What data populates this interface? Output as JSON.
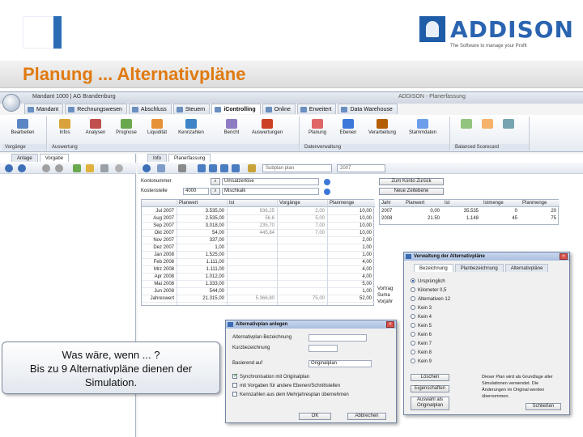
{
  "slide": {
    "title": "Planung ... Alternativpläne",
    "logo_name": "ADDISON",
    "logo_tagline": "The Software to manage your Profit",
    "callout_line1": "Was wäre, wenn ... ?",
    "callout_line2": "Bis zu 9 Alternativpläne dienen der",
    "callout_line3": "Simulation."
  },
  "app": {
    "title": "Mandant 1000 | AG Brandenburg",
    "title_right": "ADDISON - Planerfassung",
    "menu_tabs": [
      "Mandant",
      "Rechnungswesen",
      "Abschluss",
      "Steuern",
      "iControlling",
      "Online",
      "Erweitert",
      "Data Warehouse"
    ],
    "ribbon": {
      "groups": [
        "Vorgänge",
        "Auswertung",
        "Datenverwaltung",
        "Balanced Scorecard"
      ],
      "buttons": [
        "Bearbeiten",
        "Infos",
        "Analysen",
        "Prognose",
        "Liquidität",
        "Kennzahlen",
        "Bericht",
        "Auswertungen",
        "Planung",
        "Ebenen",
        "Verarbeitung",
        "Stammdaten"
      ]
    },
    "left_tabs": [
      "Anlage",
      "Vorgabe"
    ],
    "main_tabs": [
      "Info",
      "Planerfassung"
    ],
    "combo_plan": "Subplan plan",
    "combo_year": "2007"
  },
  "form": {
    "label_konto": "Kontonummer",
    "konto_value": "Umsatzerlöse",
    "label_kostenstelle": "Kostenstelle",
    "kostenstelle_num": "4000",
    "kostenstelle_value": "Mischkalk",
    "btn_zum_konto": "Zum Konto Zurück",
    "btn_neue_zeile": "Neue Zeitebene",
    "col_planwert": "Planwert",
    "col_ist": "Ist",
    "col_vorgang": "Vorgänge",
    "col_planmenge": "Planmenge",
    "right_cols": [
      "Jahr",
      "Planwert",
      "Ist",
      "Istmenge",
      "Planmenge"
    ],
    "right_rows": [
      [
        "2007",
        "0,00",
        "35.535",
        "0",
        "20"
      ],
      [
        "2008",
        "21.50",
        "1,148",
        "45",
        "75"
      ]
    ],
    "months": [
      {
        "m": "Jul 2007",
        "plan": "3.535,00",
        "ist": "936,25",
        "v": "2,00",
        "pm": "10,00"
      },
      {
        "m": "Aug 2007",
        "plan": "2.535,00",
        "ist": "56,6",
        "v": "5,00",
        "pm": "10,00"
      },
      {
        "m": "Sep 2007",
        "plan": "3.018,00",
        "ist": "235,70",
        "v": "7,00",
        "pm": "10,00"
      },
      {
        "m": "Okt 2007",
        "plan": "54,00",
        "ist": "445,84",
        "v": "7,00",
        "pm": "10,00"
      },
      {
        "m": "Nov 2007",
        "plan": "337,00",
        "ist": "",
        "v": "",
        "pm": "2,00"
      },
      {
        "m": "Dez 2007",
        "plan": "1,00",
        "ist": "",
        "v": "",
        "pm": "1,00"
      },
      {
        "m": "Jan 2008",
        "plan": "1.525,00",
        "ist": "",
        "v": "",
        "pm": "1,00"
      },
      {
        "m": "Feb 2008",
        "plan": "1.111,00",
        "ist": "",
        "v": "",
        "pm": "4,00"
      },
      {
        "m": "Mrz 2008",
        "plan": "1.111,00",
        "ist": "",
        "v": "",
        "pm": "4,00"
      },
      {
        "m": "Apr 2008",
        "plan": "1.012,00",
        "ist": "",
        "v": "",
        "pm": "4,00"
      },
      {
        "m": "Mai 2008",
        "plan": "1.333,00",
        "ist": "",
        "v": "",
        "pm": "5,00"
      },
      {
        "m": "Jun 2008",
        "plan": "544,00",
        "ist": "",
        "v": "",
        "pm": "1,00"
      },
      {
        "m": "Jahreswert",
        "plan": "21.315,00",
        "ist": "5.366,80",
        "v": "75,00",
        "pm": "52,00"
      }
    ],
    "side_labels": [
      "Vortrag",
      "Suma",
      "Vorjahr"
    ]
  },
  "dialog_verwaltung": {
    "title": "Verwaltung der Alternativpläne",
    "tabs": [
      "Bezeichnung",
      "Planbezeichnung",
      "Alternativpläne"
    ],
    "options": [
      "Ursprünglich",
      "Kilometer 0,5",
      "Alternativen 12",
      "Kein 3",
      "Kein 4",
      "Kein 5",
      "Kein 6",
      "Kein 7",
      "Kein 8",
      "Kein 9"
    ],
    "btn_loeschen": "Löschen",
    "btn_eigenschaften": "Eigenschaften",
    "btn_auswahl": "Auswahl als Originalplan",
    "btn_schliessen": "Schließen",
    "info_text": "Dieser Plan wird als Grundlage aller Simulationen verwendet. Die Änderungen im Original werden übernommen."
  },
  "dialog_anlegen": {
    "title": "Alternativplan anlegen",
    "label_bezeichnung": "Alternativplan-Bezeichnung",
    "label_kurz": "Kurzbezeichnung",
    "label_basiert": "Basierend auf",
    "basiert_value": "Originalplan",
    "check1": "Synchronisation mit Originalplan",
    "check2": "mit Vorgaben für andere Ebenen/Schnittstellen",
    "check3": "Kennzahlen aus dem Mehrjahresplan übernehmen",
    "btn_ok": "OK",
    "btn_abbrechen": "Abbrechen"
  },
  "colors": {
    "accent_orange": "#e07a10",
    "brand_blue": "#2a64b0"
  }
}
